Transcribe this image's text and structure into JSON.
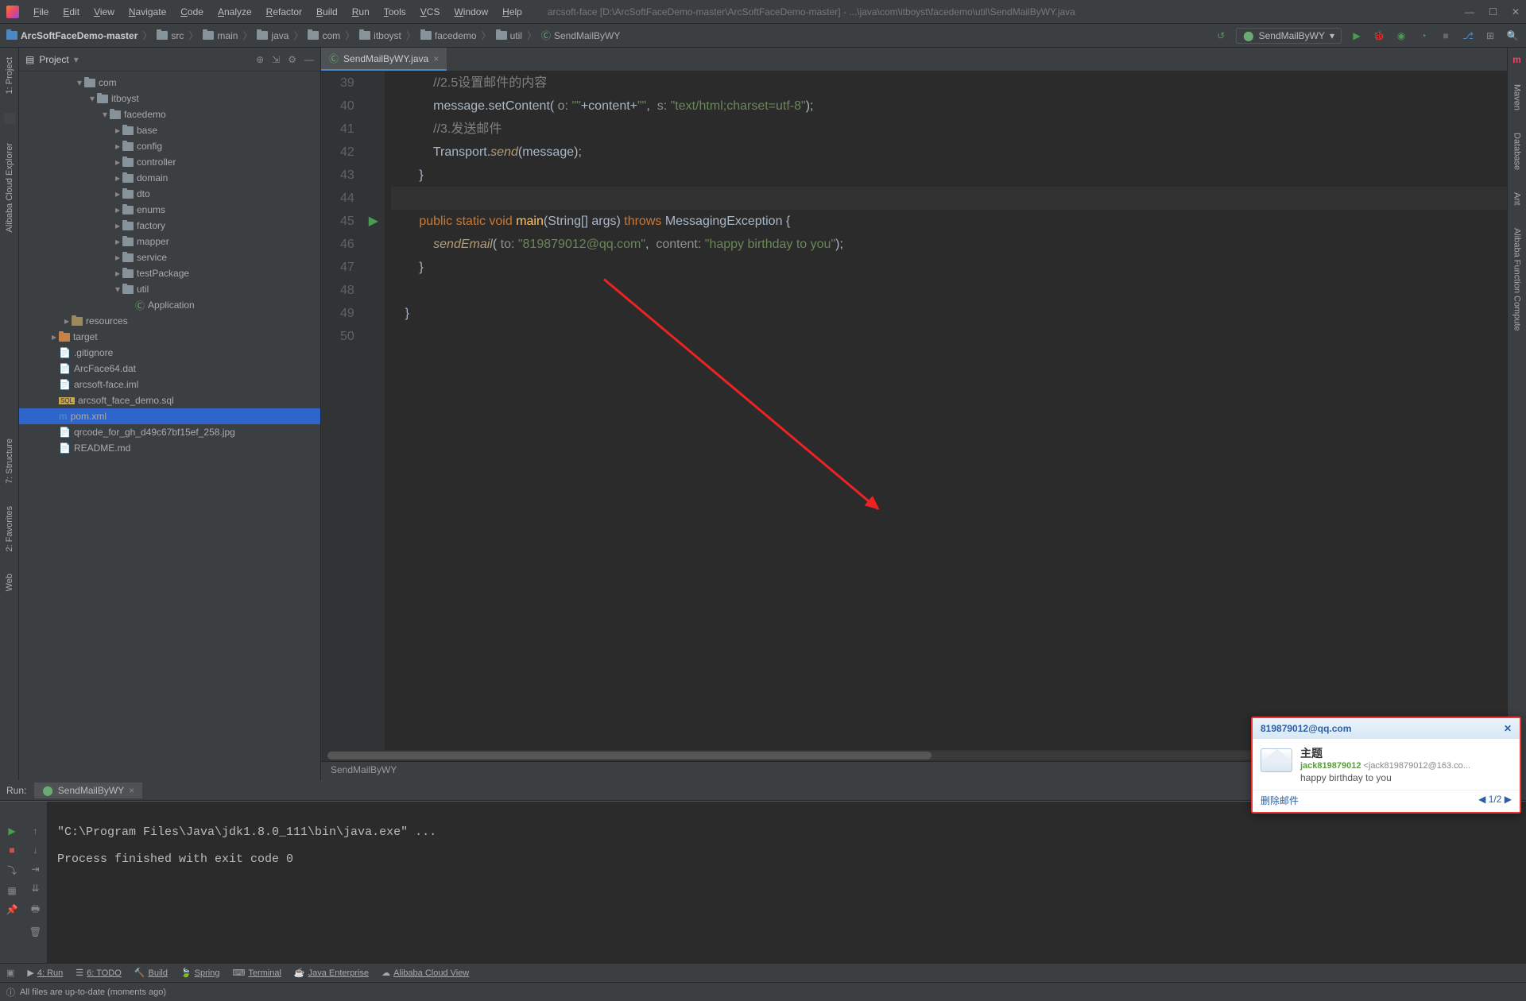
{
  "menu": [
    "File",
    "Edit",
    "View",
    "Navigate",
    "Code",
    "Analyze",
    "Refactor",
    "Build",
    "Run",
    "Tools",
    "VCS",
    "Window",
    "Help"
  ],
  "title_path": "arcsoft-face [D:\\ArcSoftFaceDemo-master\\ArcSoftFaceDemo-master] - ...\\java\\com\\itboyst\\facedemo\\util\\SendMailByWY.java",
  "breadcrumb": [
    "ArcSoftFaceDemo-master",
    "src",
    "main",
    "java",
    "com",
    "itboyst",
    "facedemo",
    "util",
    "SendMailByWY"
  ],
  "run_config": "SendMailByWY",
  "project_label": "Project",
  "tree": [
    {
      "indent": 4,
      "toggle": "▾",
      "icon": "folder",
      "label": "com"
    },
    {
      "indent": 5,
      "toggle": "▾",
      "icon": "folder",
      "label": "itboyst"
    },
    {
      "indent": 6,
      "toggle": "▾",
      "icon": "folder",
      "label": "facedemo"
    },
    {
      "indent": 7,
      "toggle": "▸",
      "icon": "folder",
      "label": "base"
    },
    {
      "indent": 7,
      "toggle": "▸",
      "icon": "folder",
      "label": "config"
    },
    {
      "indent": 7,
      "toggle": "▸",
      "icon": "folder",
      "label": "controller"
    },
    {
      "indent": 7,
      "toggle": "▸",
      "icon": "folder",
      "label": "domain"
    },
    {
      "indent": 7,
      "toggle": "▸",
      "icon": "folder",
      "label": "dto"
    },
    {
      "indent": 7,
      "toggle": "▸",
      "icon": "folder",
      "label": "enums"
    },
    {
      "indent": 7,
      "toggle": "▸",
      "icon": "folder",
      "label": "factory"
    },
    {
      "indent": 7,
      "toggle": "▸",
      "icon": "folder",
      "label": "mapper"
    },
    {
      "indent": 7,
      "toggle": "▸",
      "icon": "folder",
      "label": "service"
    },
    {
      "indent": 7,
      "toggle": "▸",
      "icon": "folder",
      "label": "testPackage"
    },
    {
      "indent": 7,
      "toggle": "▾",
      "icon": "folder",
      "label": "util"
    },
    {
      "indent": 8,
      "toggle": "",
      "icon": "class",
      "label": "Application"
    },
    {
      "indent": 3,
      "toggle": "▸",
      "icon": "folder-res",
      "label": "resources"
    },
    {
      "indent": 2,
      "toggle": "▸",
      "icon": "folder-orange",
      "label": "target"
    },
    {
      "indent": 2,
      "toggle": "",
      "icon": "file",
      "label": ".gitignore"
    },
    {
      "indent": 2,
      "toggle": "",
      "icon": "file",
      "label": "ArcFace64.dat"
    },
    {
      "indent": 2,
      "toggle": "",
      "icon": "file",
      "label": "arcsoft-face.iml"
    },
    {
      "indent": 2,
      "toggle": "",
      "icon": "sql",
      "label": "arcsoft_face_demo.sql"
    },
    {
      "indent": 2,
      "toggle": "",
      "icon": "maven",
      "label": "pom.xml",
      "selected": true
    },
    {
      "indent": 2,
      "toggle": "",
      "icon": "file",
      "label": "qrcode_for_gh_d49c67bf15ef_258.jpg"
    },
    {
      "indent": 2,
      "toggle": "",
      "icon": "file",
      "label": "README.md"
    }
  ],
  "editor_tab": "SendMailByWY.java",
  "line_start": 39,
  "code_lines": [
    {
      "n": 39,
      "html": "            <span class='k-comment'>//2.5设置邮件的内容</span>"
    },
    {
      "n": 40,
      "html": "            message.setContent( <span class='k-param'>o:</span> <span class='k-string'>\"\"</span>+content+<span class='k-string'>\"\"</span>,  <span class='k-param'>s:</span> <span class='k-string'>\"text/html;charset=utf-8\"</span>);"
    },
    {
      "n": 41,
      "html": "            <span class='k-comment'>//3.发送邮件</span>"
    },
    {
      "n": 42,
      "html": "            Transport.<span class='k-method-it'>send</span>(message);"
    },
    {
      "n": 43,
      "html": "        }"
    },
    {
      "n": 44,
      "html": "",
      "hl": true
    },
    {
      "n": 45,
      "html": "        <span class='k-keyword'>public static void</span> <span style='color:#ffc66d'>main</span>(String[] args) <span class='k-keyword'>throws</span> MessagingException {",
      "play": true
    },
    {
      "n": 46,
      "html": "            <span class='k-method-it'>sendEmail</span>( <span class='k-param'>to:</span> <span class='k-string'>\"819879012@qq.com\"</span>,  <span class='k-param'>content:</span> <span class='k-string'>\"happy birthday to you\"</span>);"
    },
    {
      "n": 47,
      "html": "        }"
    },
    {
      "n": 48,
      "html": ""
    },
    {
      "n": 49,
      "html": "    }"
    },
    {
      "n": 50,
      "html": ""
    }
  ],
  "breadcrumb_bottom": "SendMailByWY",
  "run_label": "Run:",
  "run_tab": "SendMailByWY",
  "console_text": "\"C:\\Program Files\\Java\\jdk1.8.0_111\\bin\\java.exe\" ...\n\nProcess finished with exit code 0",
  "bottom_items": [
    "4: Run",
    "6: TODO",
    "Build",
    "Spring",
    "Terminal",
    "Java Enterprise",
    "Alibaba Cloud View"
  ],
  "status_text": "All files are up-to-date (moments ago)",
  "left_tabs": [
    "1: Project",
    "Alibaba Cloud Explorer"
  ],
  "left_tabs2": [
    "7: Structure",
    "2: Favorites",
    "Web"
  ],
  "right_tabs": [
    "Maven",
    "Database",
    "Ant",
    "Alibaba Function Compute"
  ],
  "notif": {
    "from": "819879012@qq.com",
    "subject": "主题",
    "sender_name": "jack819879012",
    "sender_mail": "<jack819879012@163.co...",
    "body": "happy birthday to you",
    "delete": "删除邮件",
    "page": "1/2"
  }
}
